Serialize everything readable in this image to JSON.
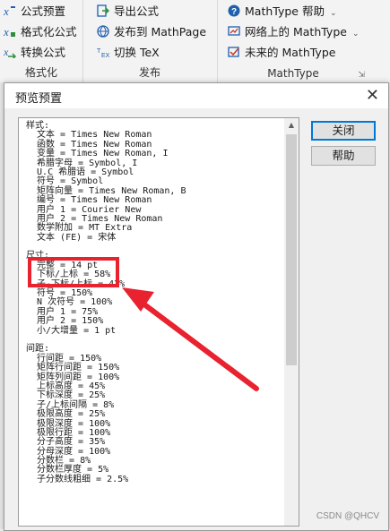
{
  "ribbon": {
    "group1": {
      "items": [
        "公式预置",
        "格式化公式",
        "转换公式"
      ],
      "label": "格式化"
    },
    "group2": {
      "items": [
        "导出公式",
        "发布到 MathPage",
        "切换 TeX"
      ],
      "label": "发布"
    },
    "group3": {
      "items": [
        "MathType 帮助",
        "网络上的 MathType",
        "未来的 MathType"
      ],
      "label": "MathType"
    }
  },
  "dialog": {
    "title": "预览预置",
    "close_button": "关闭",
    "help_button": "帮助",
    "lines": [
      "样式:",
      "  文本 = Times New Roman",
      "  函数 = Times New Roman",
      "  变量 = Times New Roman, I",
      "  希腊字母 = Symbol, I",
      "  U.C 希腊语 = Symbol",
      "  符号 = Symbol",
      "  矩阵向量 = Times New Roman, B",
      "  编号 = Times New Roman",
      "  用户 1 = Courier New",
      "  用户 2 = Times New Roman",
      "  数学附加 = MT Extra",
      "  文本 (FE) = 宋体",
      "",
      "尺寸:",
      "  完整 = 14 pt",
      "  下标/上标 = 58%",
      "  子-下标/上标 = 42%",
      "  符号 = 150%",
      "  N 次符号 = 100%",
      "  用户 1 = 75%",
      "  用户 2 = 150%",
      "  小/大增量 = 1 pt",
      "",
      "间距:",
      "  行间距 = 150%",
      "  矩阵行间距 = 150%",
      "  矩阵列间距 = 100%",
      "  上标高度 = 45%",
      "  下标深度 = 25%",
      "  子/上标间隔 = 8%",
      "  极限高度 = 25%",
      "  极限深度 = 100%",
      "  极限行距 = 100%",
      "  分子高度 = 35%",
      "  分母深度 = 100%",
      "  分数栏 = 8%",
      "  分数栏厚度 = 5%",
      "  子分数线粗细 = 2.5%"
    ]
  },
  "watermark": "CSDN @QHCV",
  "colors": {
    "highlight": "#e8222f",
    "default_button_border": "#0078d7"
  }
}
